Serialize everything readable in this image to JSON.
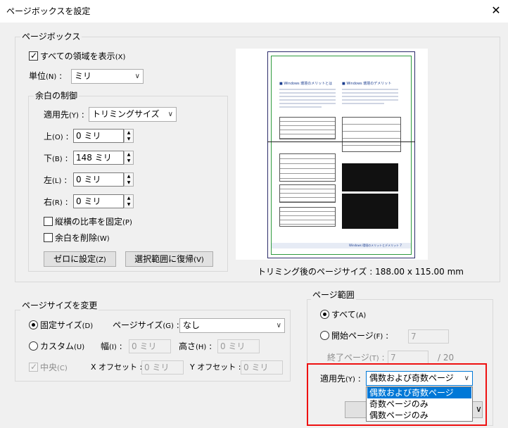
{
  "dialog": {
    "title": "ページボックスを設定",
    "close_icon": "close-icon"
  },
  "page_box": {
    "legend": "ページボックス",
    "show_all": "すべての領域を表示",
    "show_all_key": "(X)",
    "units_label": "単位",
    "units_key": "(N)",
    "units_value": "ミリ"
  },
  "margin_control": {
    "legend": "余白の制御",
    "apply_to_label": "適用先",
    "apply_to_key": "(Y)",
    "apply_to_value": "トリミングサイズ",
    "top_label": "上",
    "top_key": "(O)",
    "top_value": "0 ミリ",
    "bottom_label": "下",
    "bottom_key": "(B)",
    "bottom_value": "148 ミリ",
    "left_label": "左",
    "left_key": "(L)",
    "left_value": "0 ミリ",
    "right_label": "右",
    "right_key": "(R)",
    "right_value": "0 ミリ",
    "constrain": "縦横の比率を固定",
    "constrain_key": "(P)",
    "remove_white": "余白を削除",
    "remove_white_key": "(W)",
    "zero_button": "ゼロに設定",
    "zero_key": "(Z)",
    "revert_button": "選択範囲に復帰",
    "revert_key": "(V)"
  },
  "preview": {
    "trim_size_text": "トリミング後のページサイズ : 188.00 x 115.00 mm",
    "heading_left": "■ Windows 環境のメリットとは",
    "heading_right": "■ Windows 環境のデメリット",
    "footer_text": "Windows 環境のメリットとデメリット 7"
  },
  "page_size": {
    "legend": "ページサイズを変更",
    "fixed": "固定サイズ",
    "fixed_key": "(D)",
    "page_size_label": "ページサイズ",
    "page_size_key": "(G)",
    "page_size_value": "なし",
    "custom": "カスタム",
    "custom_key": "(U)",
    "width_label": "幅",
    "width_key": "(I)",
    "width_value": "0 ミリ",
    "height_label": "高さ",
    "height_key": "(H)",
    "height_value": "0 ミリ",
    "center": "中央",
    "center_key": "(C)",
    "x_offset_label": "X オフセット :",
    "x_offset_value": "0 ミリ",
    "y_offset_label": "Y オフセット :",
    "y_offset_value": "0 ミリ"
  },
  "page_range": {
    "legend": "ページ範囲",
    "all": "すべて",
    "all_key": "(A)",
    "from": "開始ページ",
    "from_key": "(F)",
    "from_value": "7",
    "to": "終了ページ",
    "to_key": "(T)",
    "to_value": "7",
    "total": "/ 20",
    "apply_label": "適用先",
    "apply_key": "(Y)",
    "apply_value": "偶数および奇数ページ",
    "options": [
      "偶数および奇数ページ",
      "奇数ページのみ",
      "偶数ページのみ"
    ]
  },
  "colors": {
    "highlight": "#0078d7",
    "callout": "#e11111",
    "trim_green": "#2e9a3e"
  }
}
